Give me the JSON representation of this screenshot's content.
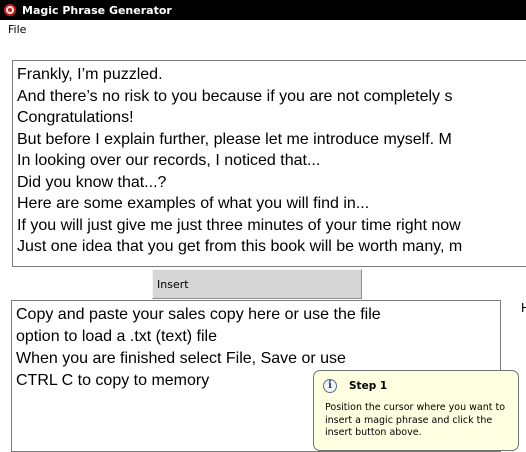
{
  "window": {
    "title": "Magic Phrase Generator",
    "icon": "app-icon"
  },
  "menu": {
    "items": [
      "File"
    ]
  },
  "phrases": {
    "items": [
      "Frankly, I’m puzzled.",
      "And there’s no risk to you because if you are not completely s",
      "Congratulations!",
      "But before I explain further, please let me introduce myself. M",
      "In looking over our records, I noticed that...",
      "Did you know that...?",
      "Here are some examples of what you will find in...",
      "If you will just give me just three minutes of your time right now",
      "Just one idea that you get from this book will be worth many, m"
    ]
  },
  "insert_button": {
    "label": "Insert"
  },
  "sales_box": {
    "text": "Copy and paste your sales copy here or use the file\noption to load a .txt (text) file\nWhen you are finished select File, Save or use\nCTRL C to copy to memory"
  },
  "side_label": {
    "text": "H"
  },
  "tooltip": {
    "icon": "info-icon",
    "title": "Step 1",
    "body": "Position the cursor where you want to insert a magic phrase and click the insert button above."
  },
  "colors": {
    "titlebar": "#000000",
    "tooltip_bg": "#ffffe1",
    "button_face": "#d6d6d6"
  }
}
